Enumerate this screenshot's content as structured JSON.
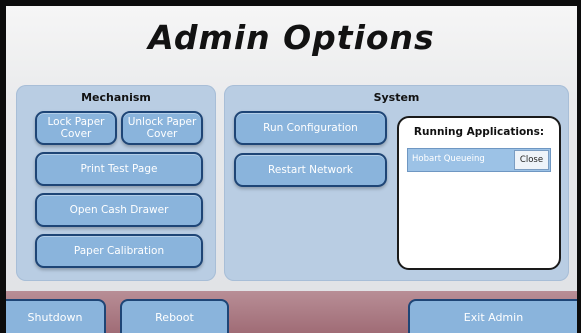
{
  "title": "Admin Options",
  "mechanism": {
    "heading": "Mechanism",
    "buttons": {
      "lock_paper_cover": "Lock Paper Cover",
      "unlock_paper_cover": "Unlock Paper Cover",
      "print_test_page": "Print Test Page",
      "open_cash_drawer": "Open Cash Drawer",
      "paper_calibration": "Paper Calibration"
    }
  },
  "system": {
    "heading": "System",
    "buttons": {
      "run_configuration": "Run Configuration",
      "restart_network": "Restart Network"
    },
    "running_applications": {
      "heading": "Running Applications:",
      "items": [
        {
          "name": "Hobart Queueing",
          "close_label": "Close"
        }
      ]
    }
  },
  "footer": {
    "shutdown": "Shutdown",
    "reboot": "Reboot",
    "exit_admin": "Exit Admin"
  },
  "colors": {
    "button_fill": "#8ab4dc",
    "button_border": "#1e4576",
    "panel_fill": "#b9cde3",
    "footer_fill": "#a06c76"
  }
}
